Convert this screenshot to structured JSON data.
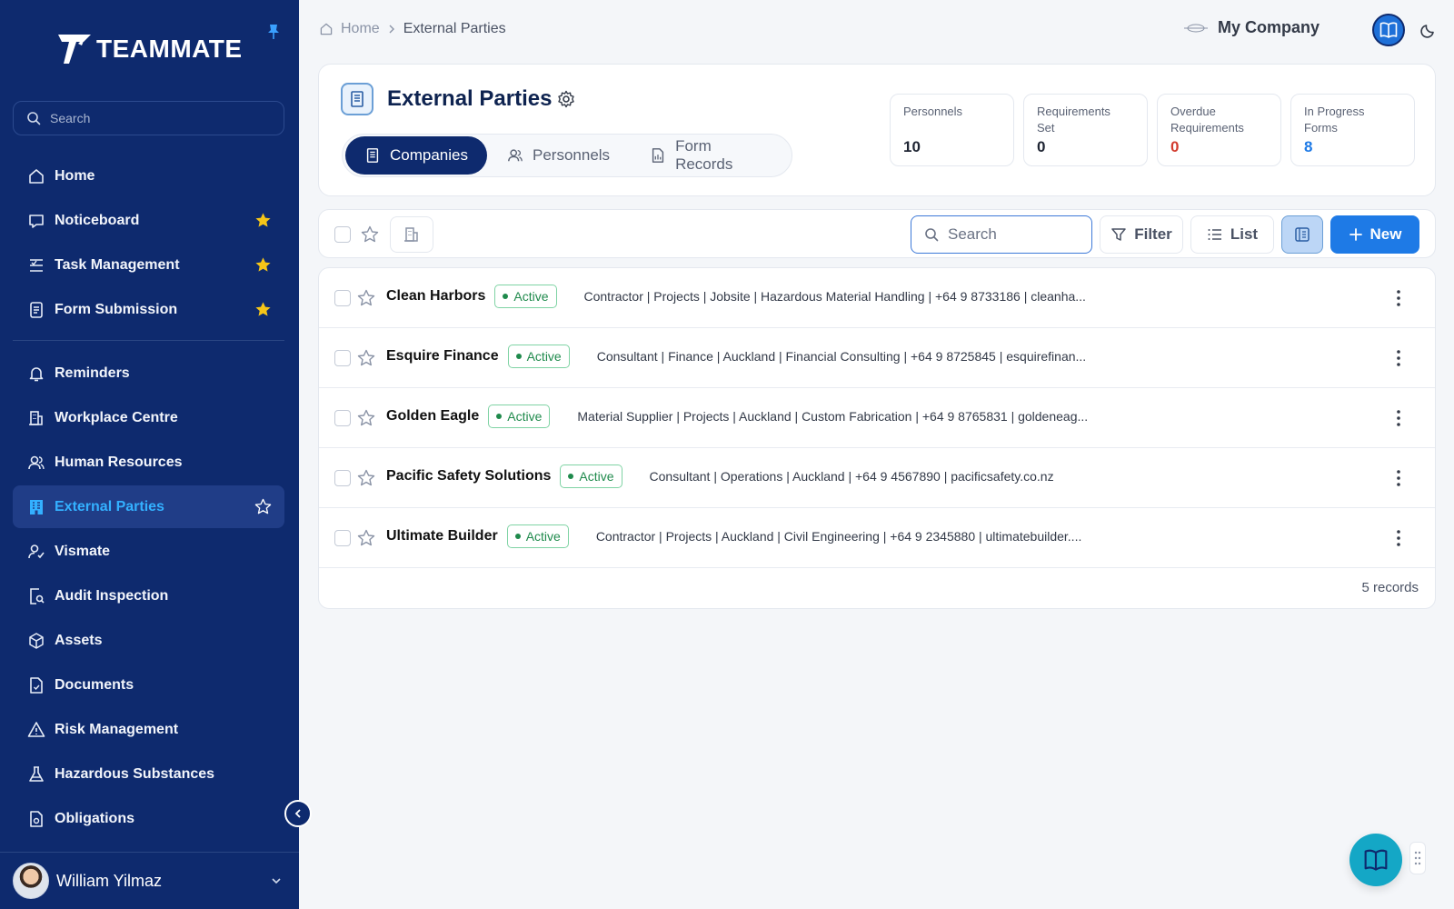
{
  "brand": {
    "name": "TEAMMATE"
  },
  "sidebar": {
    "search_placeholder": "Search",
    "items_primary": [
      {
        "label": "Home",
        "icon": "home-icon",
        "starred": false
      },
      {
        "label": "Noticeboard",
        "icon": "chat-icon",
        "starred": true
      },
      {
        "label": "Task Management",
        "icon": "tasks-icon",
        "starred": true
      },
      {
        "label": "Form Submission",
        "icon": "form-icon",
        "starred": true
      }
    ],
    "items_secondary": [
      {
        "label": "Reminders",
        "icon": "bell-icon"
      },
      {
        "label": "Workplace Centre",
        "icon": "building-icon"
      },
      {
        "label": "Human Resources",
        "icon": "people-icon"
      },
      {
        "label": "External Parties",
        "icon": "external-parties-icon",
        "active": true
      },
      {
        "label": "Vismate",
        "icon": "person-check-icon"
      },
      {
        "label": "Audit Inspection",
        "icon": "audit-icon"
      },
      {
        "label": "Assets",
        "icon": "cube-icon"
      },
      {
        "label": "Documents",
        "icon": "document-icon"
      },
      {
        "label": "Risk Management",
        "icon": "warning-icon"
      },
      {
        "label": "Hazardous Substances",
        "icon": "flask-icon"
      },
      {
        "label": "Obligations",
        "icon": "obligation-icon"
      }
    ],
    "user": {
      "name": "William Yilmaz"
    },
    "star_color": "#f5c518",
    "active_color": "#33b0ff"
  },
  "topbar": {
    "breadcrumb": {
      "home": "Home",
      "current": "External Parties"
    },
    "company": "My Company"
  },
  "header": {
    "title": "External Parties",
    "tabs": [
      {
        "label": "Companies",
        "icon": "building-icon",
        "active": true
      },
      {
        "label": "Personnels",
        "icon": "people-icon",
        "active": false
      },
      {
        "label": "Form Records",
        "icon": "form-icon",
        "active": false
      }
    ],
    "stats": [
      {
        "label": "Personnels",
        "value": "10",
        "color": "#1f2533"
      },
      {
        "label": "Requirements Set",
        "value": "0",
        "color": "#1f2533"
      },
      {
        "label": "Overdue Requirements",
        "value": "0",
        "color": "#d23b2e"
      },
      {
        "label": "In Progress Forms",
        "value": "8",
        "color": "#1e7ae6"
      }
    ]
  },
  "toolbar": {
    "search_placeholder": "Search",
    "filter_label": "Filter",
    "list_label": "List",
    "new_label": "New"
  },
  "companies": [
    {
      "name": "Clean Harbors",
      "status": "Active",
      "details": "Contractor | Projects | Jobsite | Hazardous Material Handling | +64 9 8733186 | cleanha..."
    },
    {
      "name": "Esquire Finance",
      "status": "Active",
      "details": "Consultant | Finance | Auckland | Financial Consulting | +64 9 8725845 | esquirefinan..."
    },
    {
      "name": "Golden Eagle",
      "status": "Active",
      "details": "Material Supplier | Projects | Auckland | Custom Fabrication | +64 9 8765831 | goldeneag..."
    },
    {
      "name": "Pacific Safety Solutions",
      "status": "Active",
      "details": "Consultant | Operations | Auckland | +64 9 4567890 | pacificsafety.co.nz"
    },
    {
      "name": "Ultimate Builder",
      "status": "Active",
      "details": "Contractor | Projects | Auckland | Civil Engineering | +64 9 2345880 | ultimatebuilder...."
    }
  ],
  "footer": {
    "records": "5 records"
  }
}
